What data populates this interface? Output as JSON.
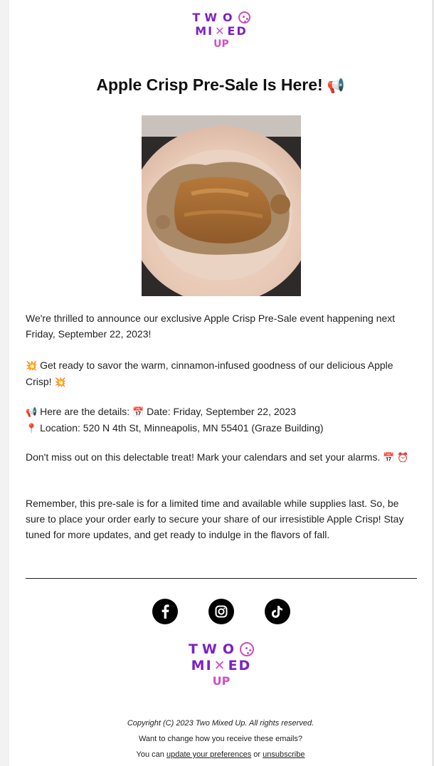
{
  "brand": {
    "line1": "TW",
    "line2a": "MI",
    "line2b": "ED",
    "line3": "UP"
  },
  "headline": {
    "text": "Apple Crisp Pre-Sale Is Here!",
    "emoji": "📢"
  },
  "content": {
    "p1": "We're thrilled to announce our exclusive Apple Crisp Pre-Sale event happening next Friday, September 22, 2023!",
    "p2_start_emoji": "💥",
    "p2": "Get ready to savor the warm, cinnamon-infused goodness of our delicious Apple Crisp!",
    "p2_end_emoji": "💥",
    "details_emoji": "📢",
    "details_lead": "Here are the details:",
    "date_emoji": "📅",
    "date_text": "Date: Friday, September 22, 2023",
    "pin_emoji": "📍",
    "location_text": "Location: 520 N 4th St, Minneapolis, MN 55401 (Graze Building)",
    "p4": "Don't miss out on this delectable treat! Mark your calendars and set your alarms.",
    "p4_emoji1": "📅",
    "p4_emoji2": "⏰",
    "p5": "Remember, this pre-sale is for a limited time and available while supplies last. So, be sure to place your order early to secure your share of our irresistible Apple Crisp! Stay tuned for more updates, and get ready to indulge in the flavors of fall."
  },
  "social": {
    "icons": [
      "facebook-icon",
      "instagram-icon",
      "tiktok-icon"
    ]
  },
  "footer": {
    "copyright": "Copyright (C) 2023 Two Mixed Up. All rights reserved.",
    "change_prompt": "Want to change how you receive these emails?",
    "you_can": "You can",
    "update_link": "update your preferences",
    "or": "or",
    "unsubscribe_link": "unsubscribe"
  },
  "colors": {
    "brand_purple": "#7c22c4",
    "brand_pink": "#d24fc6"
  }
}
